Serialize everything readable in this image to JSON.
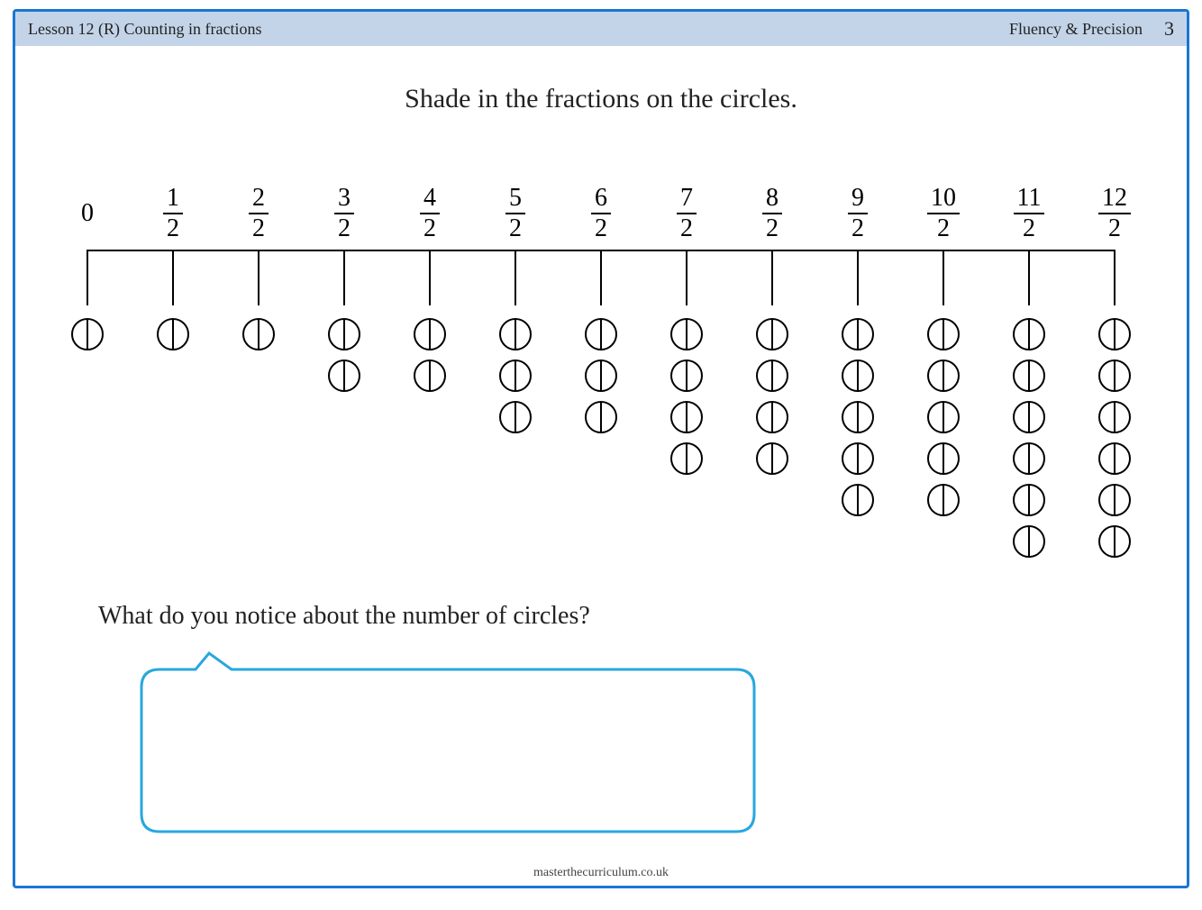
{
  "header": {
    "lesson_title": "Lesson 12 (R) Counting in fractions",
    "category": "Fluency & Precision",
    "page_number": "3"
  },
  "instruction": "Shade in the fractions on the circles.",
  "question": "What do you notice about the number of circles?",
  "footer": "masterthecurriculum.co.uk",
  "chart_data": {
    "type": "table",
    "title": "Fractions on a number line (halves) with circle representations",
    "columns": [
      {
        "label_zero": "0",
        "numerator": null,
        "denominator": null,
        "circles": 1
      },
      {
        "label_zero": null,
        "numerator": "1",
        "denominator": "2",
        "circles": 1
      },
      {
        "label_zero": null,
        "numerator": "2",
        "denominator": "2",
        "circles": 1
      },
      {
        "label_zero": null,
        "numerator": "3",
        "denominator": "2",
        "circles": 2
      },
      {
        "label_zero": null,
        "numerator": "4",
        "denominator": "2",
        "circles": 2
      },
      {
        "label_zero": null,
        "numerator": "5",
        "denominator": "2",
        "circles": 3
      },
      {
        "label_zero": null,
        "numerator": "6",
        "denominator": "2",
        "circles": 3
      },
      {
        "label_zero": null,
        "numerator": "7",
        "denominator": "2",
        "circles": 4
      },
      {
        "label_zero": null,
        "numerator": "8",
        "denominator": "2",
        "circles": 4
      },
      {
        "label_zero": null,
        "numerator": "9",
        "denominator": "2",
        "circles": 5
      },
      {
        "label_zero": null,
        "numerator": "10",
        "denominator": "2",
        "circles": 5
      },
      {
        "label_zero": null,
        "numerator": "11",
        "denominator": "2",
        "circles": 6
      },
      {
        "label_zero": null,
        "numerator": "12",
        "denominator": "2",
        "circles": 6
      }
    ]
  }
}
